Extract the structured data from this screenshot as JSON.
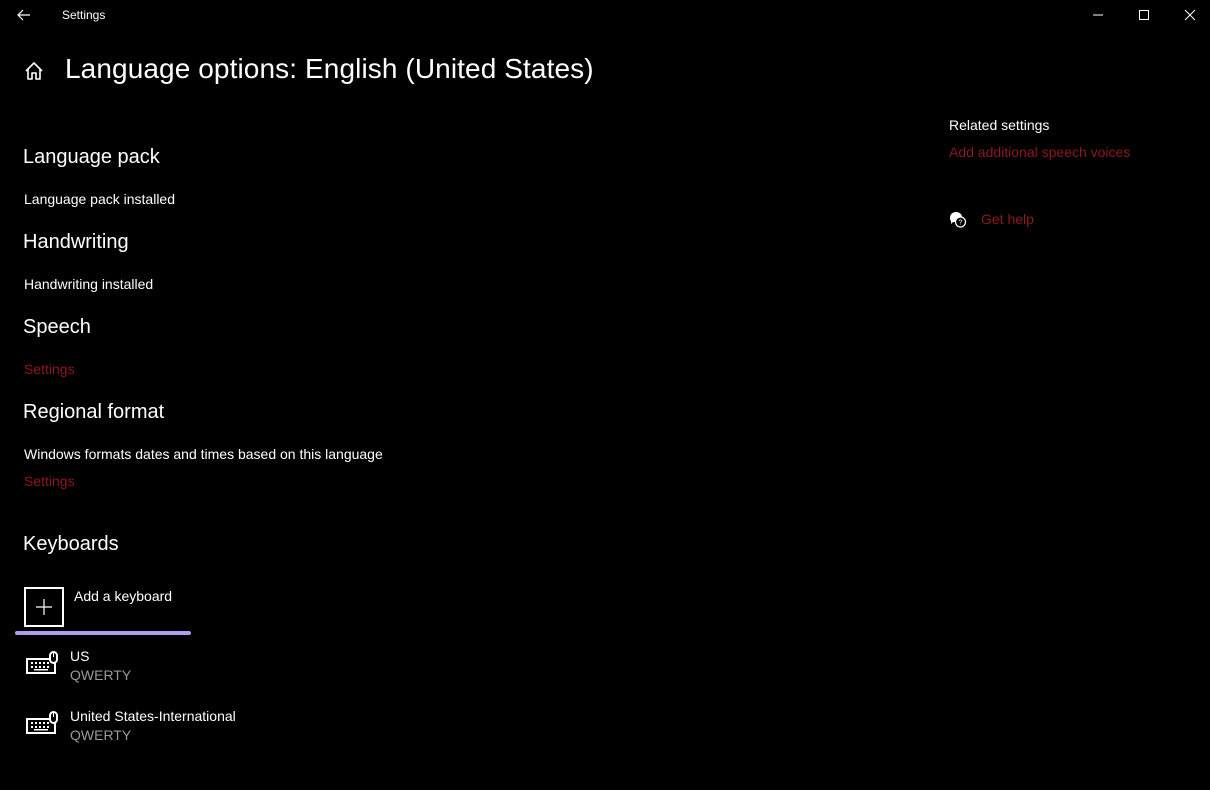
{
  "window": {
    "title": "Settings",
    "controls": {
      "minimize": "minimize-icon",
      "maximize": "maximize-icon",
      "close": "close-icon"
    }
  },
  "header": {
    "title": "Language options: English (United States)"
  },
  "sections": {
    "language_pack": {
      "heading": "Language pack",
      "status": "Language pack installed"
    },
    "handwriting": {
      "heading": "Handwriting",
      "status": "Handwriting installed"
    },
    "speech": {
      "heading": "Speech",
      "link": "Settings"
    },
    "regional_format": {
      "heading": "Regional format",
      "description": "Windows formats dates and times based on this language",
      "link": "Settings"
    },
    "keyboards": {
      "heading": "Keyboards",
      "add_label": "Add a keyboard",
      "items": [
        {
          "name": "US",
          "layout": "QWERTY"
        },
        {
          "name": "United States-International",
          "layout": "QWERTY"
        }
      ]
    }
  },
  "related": {
    "heading": "Related settings",
    "links": [
      "Add additional speech voices"
    ],
    "help_link": "Get help"
  },
  "colors": {
    "background": "#000000",
    "accent_link": "#8b1a1f",
    "focus_indicator": "#a99ff0",
    "secondary_text": "#9a9a9a"
  }
}
